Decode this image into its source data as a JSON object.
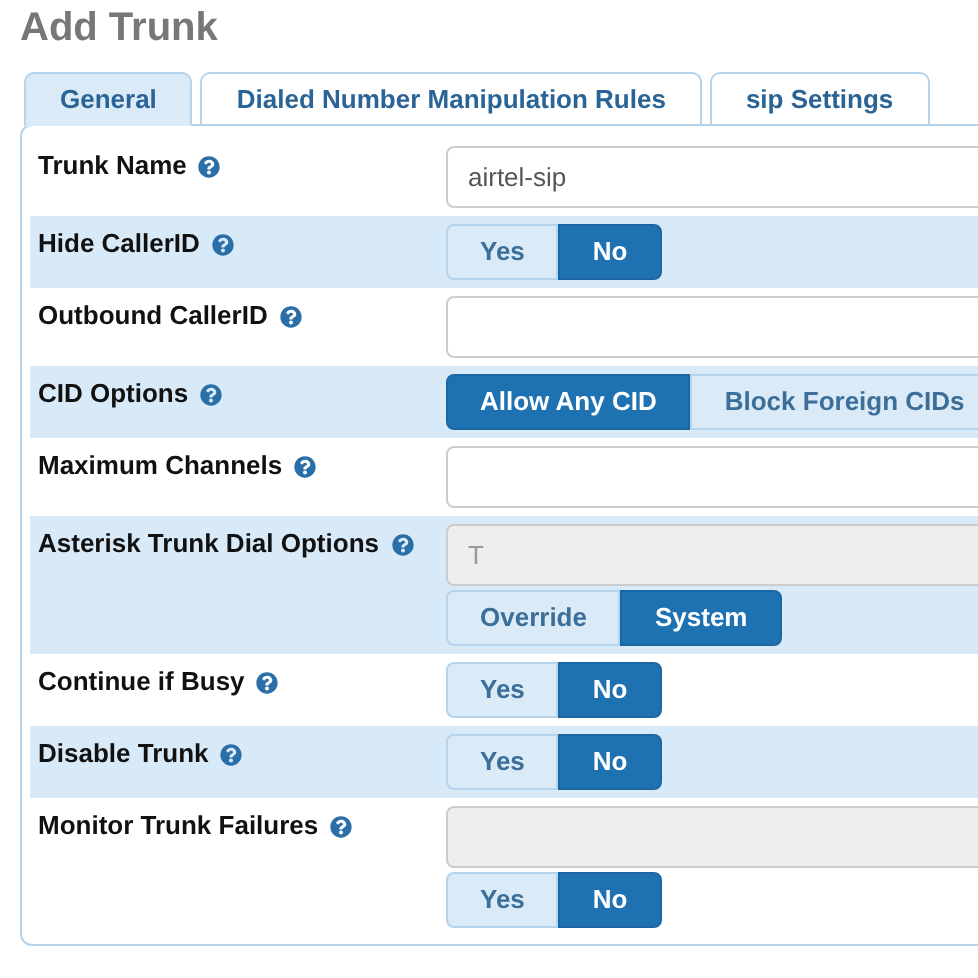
{
  "title": "Add Trunk",
  "tabs": [
    {
      "label": "General",
      "selected": true
    },
    {
      "label": "Dialed Number Manipulation Rules",
      "selected": false
    },
    {
      "label": "sip Settings",
      "selected": false
    }
  ],
  "rows": [
    {
      "label": "Trunk Name",
      "controls": [
        {
          "kind": "text",
          "value": "airtel-sip",
          "disabled": false
        }
      ]
    },
    {
      "label": "Hide CallerID",
      "controls": [
        {
          "kind": "toggle",
          "options": [
            {
              "label": "Yes",
              "selected": false
            },
            {
              "label": "No",
              "selected": true
            }
          ]
        }
      ]
    },
    {
      "label": "Outbound CallerID",
      "controls": [
        {
          "kind": "text",
          "disabled": false
        }
      ]
    },
    {
      "label": "CID Options",
      "controls": [
        {
          "kind": "toggle",
          "options": [
            {
              "label": "Allow Any CID",
              "selected": true
            },
            {
              "label": "Block Foreign CIDs",
              "selected": false
            }
          ]
        }
      ]
    },
    {
      "label": "Maximum Channels",
      "controls": [
        {
          "kind": "text",
          "disabled": false
        }
      ]
    },
    {
      "label": "Asterisk Trunk Dial Options",
      "controls": [
        {
          "kind": "text",
          "value": "T",
          "disabled": true
        },
        {
          "kind": "toggle",
          "options": [
            {
              "label": "Override",
              "selected": false
            },
            {
              "label": "System",
              "selected": true
            }
          ]
        }
      ]
    },
    {
      "label": "Continue if Busy",
      "controls": [
        {
          "kind": "toggle",
          "options": [
            {
              "label": "Yes",
              "selected": false
            },
            {
              "label": "No",
              "selected": true
            }
          ]
        }
      ]
    },
    {
      "label": "Disable Trunk",
      "controls": [
        {
          "kind": "toggle",
          "options": [
            {
              "label": "Yes",
              "selected": false
            },
            {
              "label": "No",
              "selected": true
            }
          ]
        }
      ]
    },
    {
      "label": "Monitor Trunk Failures",
      "controls": [
        {
          "kind": "text",
          "disabled": true
        },
        {
          "kind": "toggle",
          "options": [
            {
              "label": "Yes",
              "selected": false
            },
            {
              "label": "No",
              "selected": true
            }
          ]
        }
      ]
    }
  ]
}
